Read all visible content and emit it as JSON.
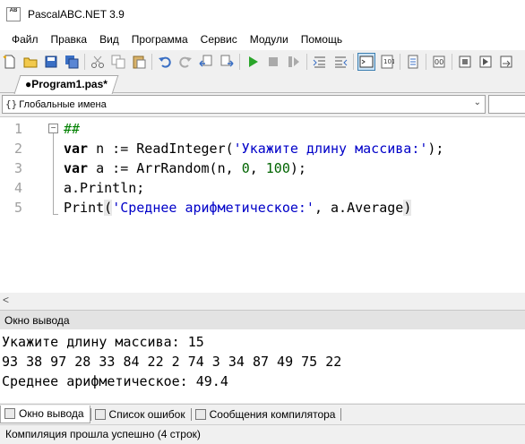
{
  "window": {
    "title": "PascalABC.NET 3.9",
    "icon_text": "AB"
  },
  "menu": [
    "Файл",
    "Правка",
    "Вид",
    "Программа",
    "Сервис",
    "Модули",
    "Помощь"
  ],
  "toolbar": {
    "buttons": [
      "new-file-icon",
      "open-icon",
      "save-icon",
      "save-all-icon",
      "cut-icon",
      "copy-icon",
      "paste-icon",
      "undo-icon",
      "redo-icon",
      "navigate-back-icon",
      "navigate-forward-icon",
      "run-icon",
      "stop-icon",
      "step-icon",
      "toggle-output-icon",
      "toggle-editor-icon",
      "format-icon",
      "settings-icon",
      "debug-icon",
      "breakpoint-icon",
      "watch-icon"
    ]
  },
  "tabs": [
    {
      "label": "●Program1.pas*"
    }
  ],
  "scope": {
    "label": "Глобальные имена",
    "icon": "{}"
  },
  "editor": {
    "line_numbers": [
      "1",
      "2",
      "3",
      "4",
      "5"
    ],
    "lines": {
      "l1": {
        "comment": "##"
      },
      "l2": {
        "kw": "var",
        "a": " n := ReadInteger(",
        "s": "'Укажите длину массива:'",
        "b": ");"
      },
      "l3": {
        "kw": "var",
        "a": " a := ArrRandom(n, ",
        "n1": "0",
        "c": ", ",
        "n2": "100",
        "b": ");"
      },
      "l4": {
        "a": "a.Println;"
      },
      "l5": {
        "a": "Print",
        "p1": "(",
        "s": "'Среднее арифметическое:'",
        "b": ", a.Average",
        "p2": ")"
      }
    }
  },
  "output": {
    "header": "Окно вывода",
    "lines": [
      "Укажите длину массива: 15",
      "93 38 97 28 33 84 22 2 74 3 34 87 49 75 22",
      "Среднее арифметическое: 49.4"
    ]
  },
  "bottom_tabs": [
    "Окно вывода",
    "Список ошибок",
    "Сообщения компилятора"
  ],
  "status": "Компиляция прошла успешно (4 строк)"
}
